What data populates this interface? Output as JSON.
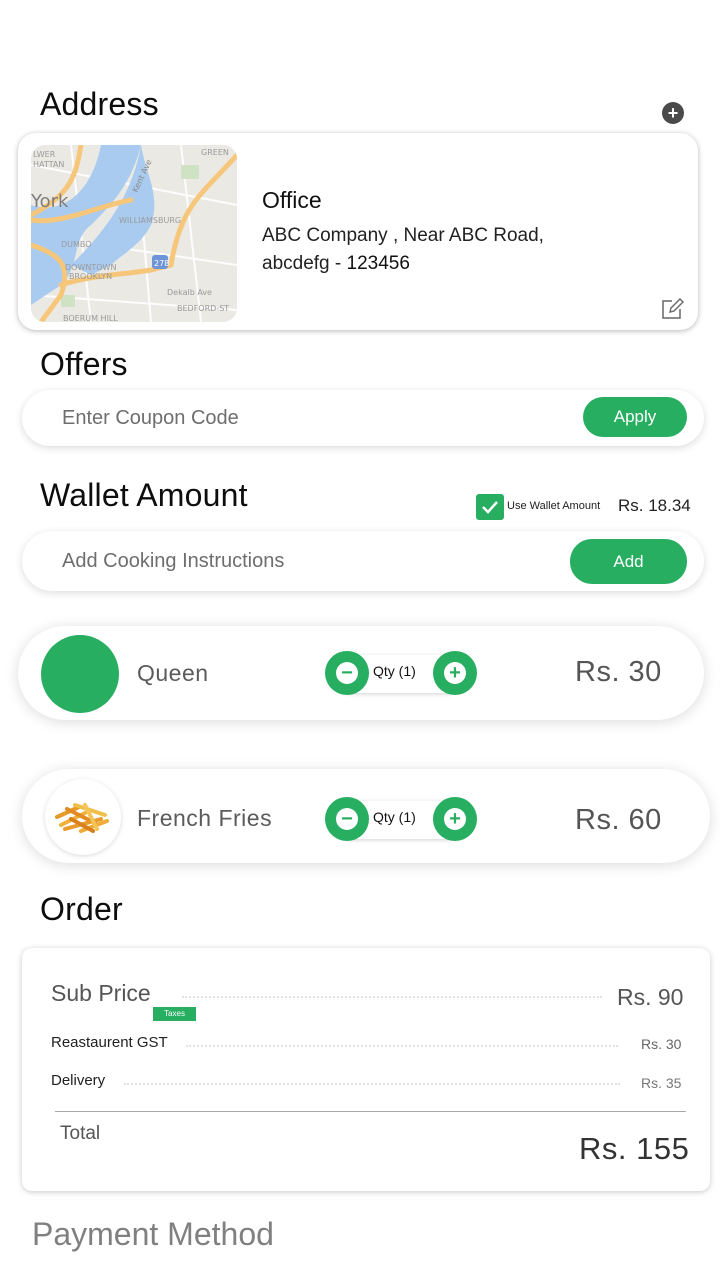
{
  "colors": {
    "accent": "#27ae60",
    "text_dark": "#111111",
    "text_muted": "#555555"
  },
  "address": {
    "title": "Address",
    "add_icon": "plus-circle-icon",
    "card": {
      "map_labels": [
        "LOWER MANHATTAN",
        "York",
        "GREEN",
        "Kent Ave",
        "WILLIAMSBURG",
        "DUMBO",
        "DOWNTOWN BROOKLYN",
        "278",
        "Dekalb Ave",
        "BEDFORD-ST",
        "BOERUM HILL"
      ],
      "label": "Office",
      "line1": "ABC Company , Near ABC Road,",
      "line2_prefix": "abcdefg - ",
      "line2_pin": "123456",
      "edit_icon": "edit-icon"
    }
  },
  "offers": {
    "title": "Offers",
    "coupon_placeholder": "Enter Coupon Code",
    "coupon_value": "",
    "apply_label": "Apply"
  },
  "wallet": {
    "title": "Wallet Amount",
    "use_wallet_label": "Use Wallet Amount",
    "use_wallet_checked": true,
    "amount": "Rs. 18.34",
    "instructions_placeholder": "Add Cooking Instructions",
    "instructions_value": "",
    "add_label": "Add"
  },
  "items": [
    {
      "name": "Queen",
      "qty_label": "Qty (1)",
      "qty": 1,
      "price": "Rs. 30",
      "image": "green-circle"
    },
    {
      "name": "French Fries",
      "qty_label": "Qty (1)",
      "qty": 1,
      "price": "Rs. 60",
      "image": "french-fries-image"
    }
  ],
  "order": {
    "title": "Order",
    "sub_price_label": "Sub Price",
    "sub_price_value": "Rs. 90",
    "taxes_badge": "Taxes",
    "gst_label": "Reastaurent GST",
    "gst_value": "Rs. 30",
    "delivery_label": "Delivery",
    "delivery_value": "Rs. 35",
    "total_label": "Total",
    "total_value": "Rs. 155"
  },
  "payment": {
    "title": "Payment Method"
  }
}
